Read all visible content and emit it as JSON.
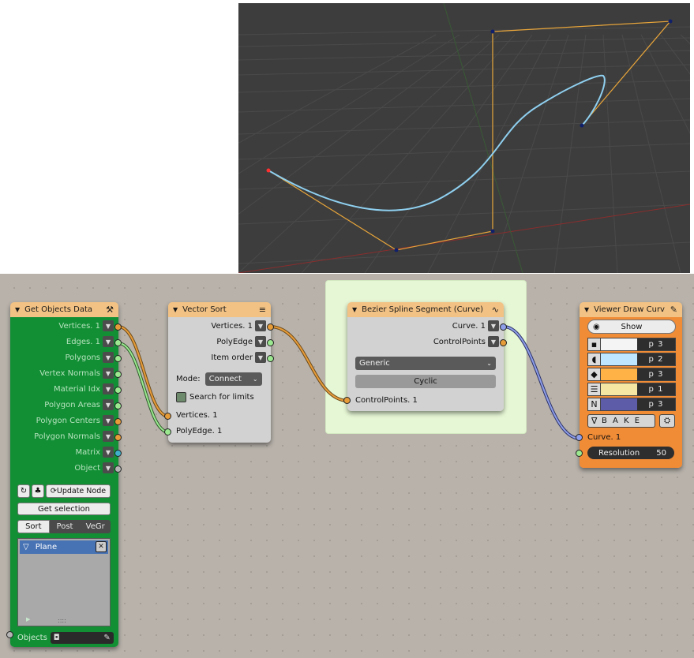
{
  "viewport": {
    "colors": {
      "background": "#3d3d3d",
      "grid": "#484848",
      "x_axis": "#8a2d2d",
      "y_axis": "#3a5a36",
      "curve": "#8fd0f0",
      "handles": "#e8a53a"
    }
  },
  "nodes": {
    "get_objects_data": {
      "title": "Get Objects Data",
      "outputs": [
        "Vertices. 1",
        "Edges. 1",
        "Polygons",
        "Vertex Normals",
        "Material Idx",
        "Polygon Areas",
        "Polygon Centers",
        "Polygon Normals",
        "Matrix",
        "Object"
      ],
      "update_label": "Update Node",
      "get_selection_label": "Get selection",
      "tabs": [
        "Sort",
        "Post",
        "VeGr"
      ],
      "active_tab": "Sort",
      "list_item": "Plane",
      "list_dots": "::::",
      "objects_label": "Objects"
    },
    "vector_sort": {
      "title": "Vector Sort",
      "outputs": [
        "Vertices. 1",
        "PolyEdge",
        "Item order"
      ],
      "mode_label": "Mode:",
      "mode_value": "Connect",
      "search_label": "Search for limits",
      "inputs": [
        "Vertices. 1",
        "PolyEdge. 1"
      ]
    },
    "bezier_spline": {
      "title": "Bezier Spline Segment (Curve)",
      "outputs": [
        "Curve. 1",
        "ControlPoints"
      ],
      "dropdown_value": "Generic",
      "cyclic_label": "Cyclic",
      "inputs": [
        "ControlPoints. 1"
      ]
    },
    "viewer_draw_curve": {
      "title": "Viewer Draw Curv",
      "show_label": "Show",
      "swatches": [
        {
          "icon": "vertex-icon",
          "color": "#f4f4f4",
          "value": "p 3"
        },
        {
          "icon": "curve-icon",
          "color": "#bfe6ff",
          "value": "p 2"
        },
        {
          "icon": "diamond-icon",
          "color": "#ffb347",
          "value": "p 3"
        },
        {
          "icon": "lines-icon",
          "color": "#f5e6a3",
          "value": "p 1"
        },
        {
          "icon": "normal-icon",
          "color": "#5c5ca8",
          "value": "p 3"
        }
      ],
      "bake_label": "B A K E",
      "inputs": [
        "Curve. 1"
      ],
      "resolution_label": "Resolution",
      "resolution_value": "50"
    }
  }
}
